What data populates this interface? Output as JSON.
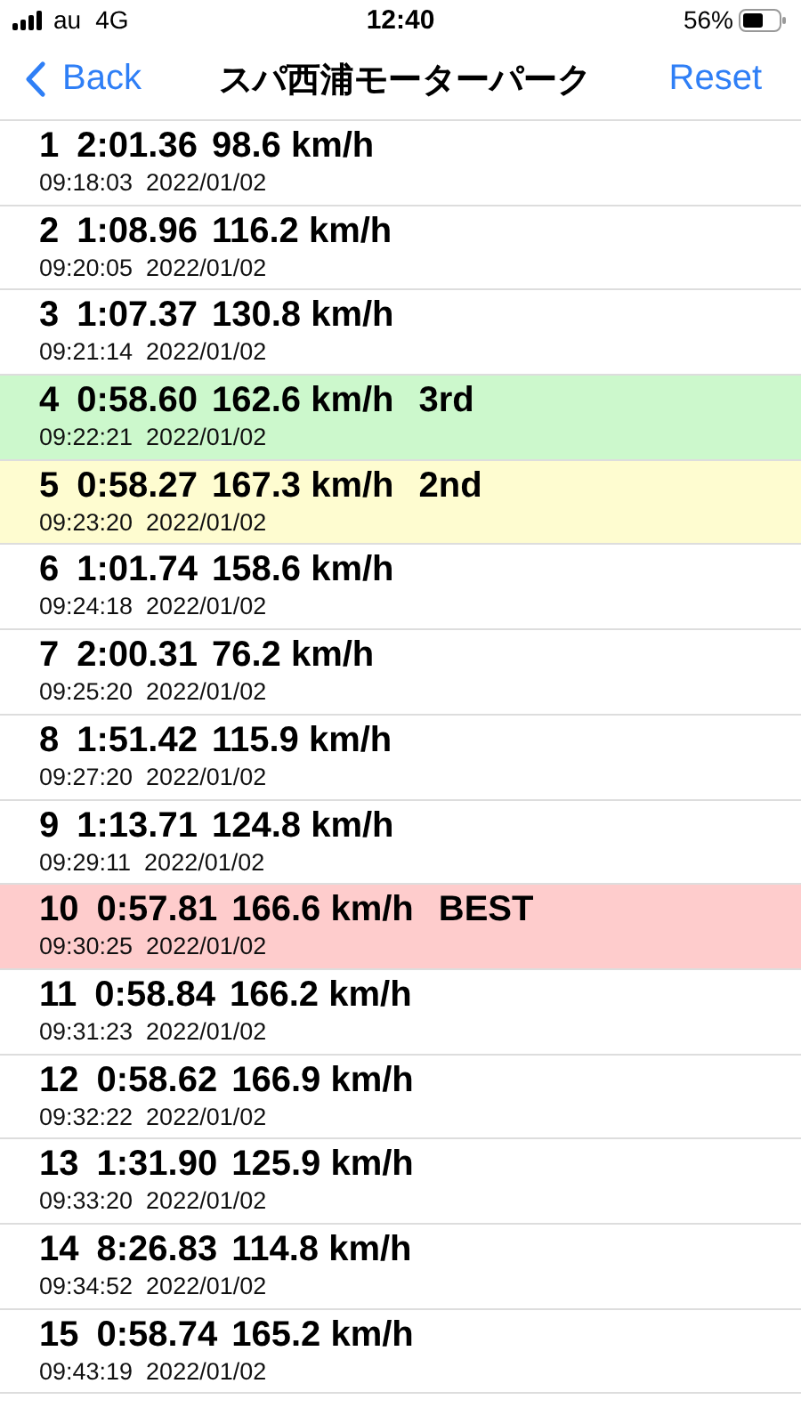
{
  "status_bar": {
    "carrier": "au",
    "network": "4G",
    "time": "12:40",
    "battery": "56%"
  },
  "nav": {
    "back": "Back",
    "title": "スパ西浦モーターパーク",
    "action": "Reset"
  },
  "laps": [
    {
      "lap": "1",
      "time": "2:01.36",
      "speed": "98.6 km/h",
      "stamp": "09:18:03  2022/01/02"
    },
    {
      "lap": "2",
      "time": "1:08.96",
      "speed": "116.2 km/h",
      "stamp": "09:20:05  2022/01/02"
    },
    {
      "lap": "3",
      "time": "1:07.37",
      "speed": "130.8 km/h",
      "stamp": "09:21:14  2022/01/02"
    },
    {
      "lap": "4",
      "time": "0:58.60",
      "speed": "162.6 km/h",
      "rank": "3rd",
      "color": "#ccf8cc",
      "stamp": "09:22:21  2022/01/02"
    },
    {
      "lap": "5",
      "time": "0:58.27",
      "speed": "167.3 km/h",
      "rank": "2nd",
      "color": "#fefcd0",
      "stamp": "09:23:20  2022/01/02"
    },
    {
      "lap": "6",
      "time": "1:01.74",
      "speed": "158.6 km/h",
      "stamp": "09:24:18  2022/01/02"
    },
    {
      "lap": "7",
      "time": "2:00.31",
      "speed": "76.2 km/h",
      "stamp": "09:25:20  2022/01/02"
    },
    {
      "lap": "8",
      "time": "1:51.42",
      "speed": "115.9 km/h",
      "stamp": "09:27:20  2022/01/02"
    },
    {
      "lap": "9",
      "time": "1:13.71",
      "speed": "124.8 km/h",
      "stamp": "09:29:11  2022/01/02"
    },
    {
      "lap": "10",
      "time": "0:57.81",
      "speed": "166.6 km/h",
      "rank": "BEST",
      "color": "#fecccc",
      "stamp": "09:30:25  2022/01/02"
    },
    {
      "lap": "11",
      "time": "0:58.84",
      "speed": "166.2 km/h",
      "stamp": "09:31:23  2022/01/02"
    },
    {
      "lap": "12",
      "time": "0:58.62",
      "speed": "166.9 km/h",
      "stamp": "09:32:22  2022/01/02"
    },
    {
      "lap": "13",
      "time": "1:31.90",
      "speed": "125.9 km/h",
      "stamp": "09:33:20  2022/01/02"
    },
    {
      "lap": "14",
      "time": "8:26.83",
      "speed": "114.8 km/h",
      "stamp": "09:34:52  2022/01/02"
    },
    {
      "lap": "15",
      "time": "0:58.74",
      "speed": "165.2 km/h",
      "stamp": "09:43:19  2022/01/02"
    }
  ]
}
